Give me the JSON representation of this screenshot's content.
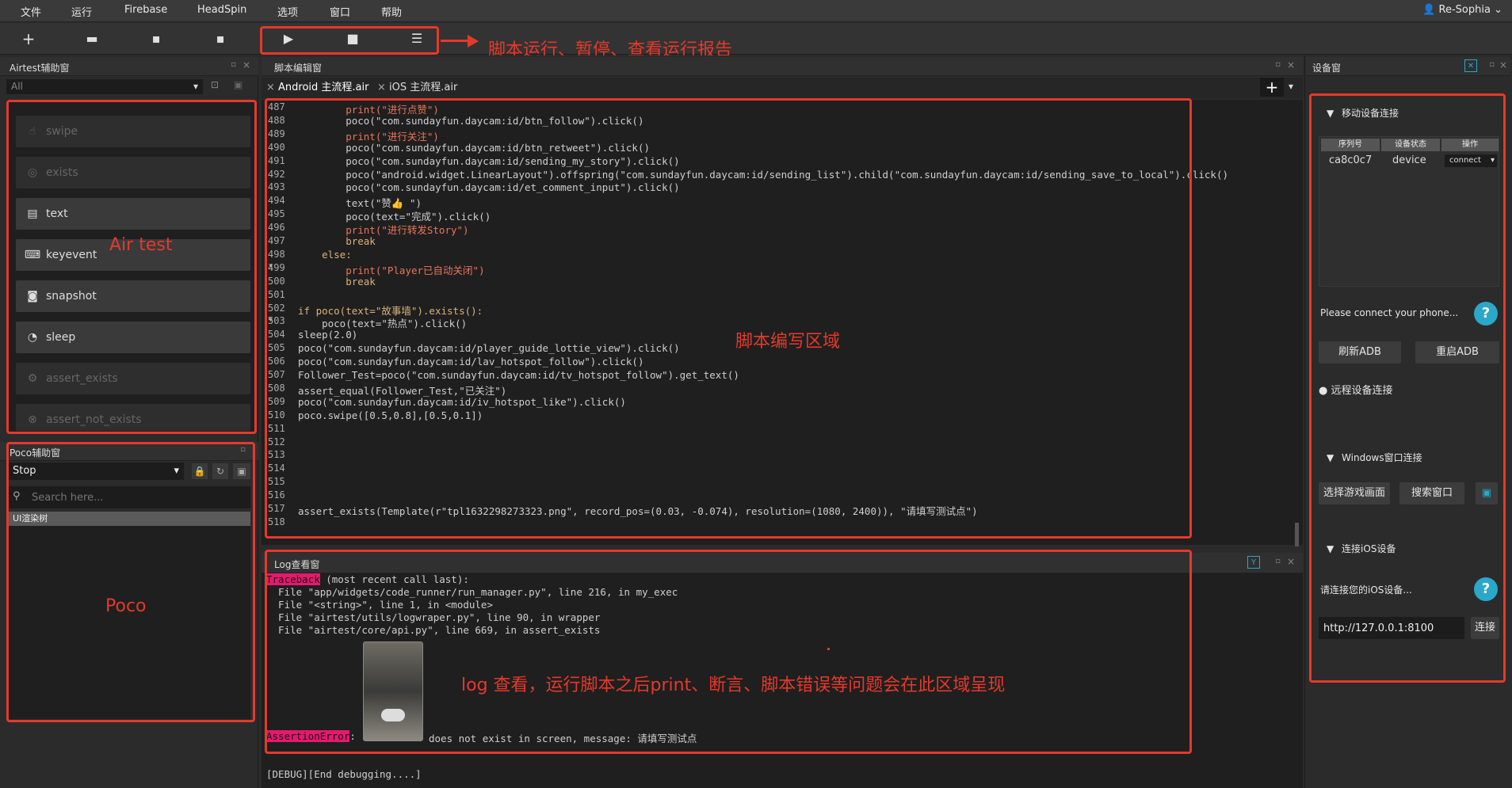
{
  "menubar": {
    "items": [
      "文件",
      "运行",
      "Firebase",
      "HeadSpin",
      "选项",
      "窗口",
      "帮助"
    ],
    "user": "Re-Sophia"
  },
  "annotations": {
    "toolbar": "脚本运行、暂停、查看运行报告",
    "airtest": "Air test",
    "editor": "脚本编写区域",
    "poco": "Poco",
    "log": "log 查看，运行脚本之后print、断言、脚本错误等问题会在此区域呈现"
  },
  "airtest_panel": {
    "title": "Airtest辅助窗",
    "filter": "All",
    "buttons": [
      "swipe",
      "exists",
      "text",
      "keyevent",
      "snapshot",
      "sleep",
      "assert_exists",
      "assert_not_exists"
    ]
  },
  "poco_panel": {
    "title": "Poco辅助窗",
    "mode": "Stop",
    "search_placeholder": "Search here...",
    "tree_label": "UI渲染树"
  },
  "editor": {
    "title": "脚本编辑窗",
    "tabs": [
      "Android 主流程.air",
      "iOS 主流程.air"
    ],
    "lines": [
      {
        "n": "487",
        "t": "        print(\"进行点赞\")"
      },
      {
        "n": "488",
        "t": "        poco(\"com.sundayfun.daycam:id/btn_follow\").click()"
      },
      {
        "n": "489",
        "t": "        print(\"进行关注\")"
      },
      {
        "n": "490",
        "t": "        poco(\"com.sundayfun.daycam:id/btn_retweet\").click()"
      },
      {
        "n": "491",
        "t": "        poco(\"com.sundayfun.daycam:id/sending_my_story\").click()"
      },
      {
        "n": "492",
        "t": "        poco(\"android.widget.LinearLayout\").offspring(\"com.sundayfun.daycam:id/sending_list\").child(\"com.sundayfun.daycam:id/sending_save_to_local\").click()"
      },
      {
        "n": "493",
        "t": "        poco(\"com.sundayfun.daycam:id/et_comment_input\").click()"
      },
      {
        "n": "494",
        "t": "        text(\"赞👍 \")"
      },
      {
        "n": "495",
        "t": "        poco(text=\"完成\").click()"
      },
      {
        "n": "496",
        "t": "        print(\"进行转发Story\")"
      },
      {
        "n": "497",
        "t": "        break"
      },
      {
        "n": "498 ▾",
        "t": "    else:"
      },
      {
        "n": "499",
        "t": "        print(\"Player已自动关闭\")"
      },
      {
        "n": "500",
        "t": "        break"
      },
      {
        "n": "501",
        "t": ""
      },
      {
        "n": "502 ▾",
        "t": "if poco(text=\"故事墙\").exists():"
      },
      {
        "n": "503",
        "t": "    poco(text=\"热点\").click()"
      },
      {
        "n": "504",
        "t": "sleep(2.0)"
      },
      {
        "n": "505",
        "t": "poco(\"com.sundayfun.daycam:id/player_guide_lottie_view\").click()"
      },
      {
        "n": "506",
        "t": "poco(\"com.sundayfun.daycam:id/lav_hotspot_follow\").click()"
      },
      {
        "n": "507",
        "t": "Follower_Test=poco(\"com.sundayfun.daycam:id/tv_hotspot_follow\").get_text()"
      },
      {
        "n": "508",
        "t": "assert_equal(Follower_Test,\"已关注\")"
      },
      {
        "n": "509",
        "t": "poco(\"com.sundayfun.daycam:id/iv_hotspot_like\").click()"
      },
      {
        "n": "510",
        "t": "poco.swipe([0.5,0.8],[0.5,0.1])"
      },
      {
        "n": "511",
        "t": ""
      },
      {
        "n": "512",
        "t": ""
      },
      {
        "n": "513",
        "t": ""
      },
      {
        "n": "514",
        "t": ""
      },
      {
        "n": "515",
        "t": ""
      },
      {
        "n": "516",
        "t": ""
      },
      {
        "n": "517",
        "t": "assert_exists(Template(r\"tpl1632298273323.png\", record_pos=(0.03, -0.074), resolution=(1080, 2400)), \"请填写测试点\")"
      },
      {
        "n": "518",
        "t": ""
      }
    ]
  },
  "log": {
    "title": "Log查看窗",
    "traceback_word": "Traceback",
    "traceback_rest": " (most recent call last):",
    "frames": [
      "  File \"app/widgets/code_runner/run_manager.py\", line 216, in my_exec",
      "  File \"<string>\", line 1, in <module>",
      "  File \"airtest/utils/logwraper.py\", line 90, in wrapper",
      "  File \"airtest/core/api.py\", line 669, in assert_exists"
    ],
    "error_word": "AssertionError",
    "error_rest": "does not exist in screen, message: 请填写测试点",
    "debug": "[DEBUG][End debugging....]"
  },
  "device_panel": {
    "title": "设备窗",
    "mobile_section": "移动设备连接",
    "table_headers": [
      "序列号",
      "设备状态",
      "操作"
    ],
    "device": {
      "serial": "ca8c0c7",
      "status": "device",
      "action": "connect"
    },
    "connect_prompt": "Please connect your phone...",
    "refresh_adb": "刷新ADB",
    "restart_adb": "重启ADB",
    "remote": "远程设备连接",
    "windows_section": "Windows窗口连接",
    "select_game": "选择游戏画面",
    "search_window": "搜索窗口",
    "ios_section": "连接iOS设备",
    "ios_prompt": "请连接您的iOS设备...",
    "ios_url": "http://127.0.0.1:8100",
    "ios_connect": "连接"
  },
  "colors": {
    "annotation": "#e5392b",
    "accent": "#2aa7c9",
    "highlight": "#e6196e"
  },
  "icons": [
    "plus-icon",
    "folder-icon",
    "save-icon",
    "save-as-icon",
    "play-icon",
    "stop-icon",
    "report-icon",
    "help-icon",
    "user-icon"
  ]
}
